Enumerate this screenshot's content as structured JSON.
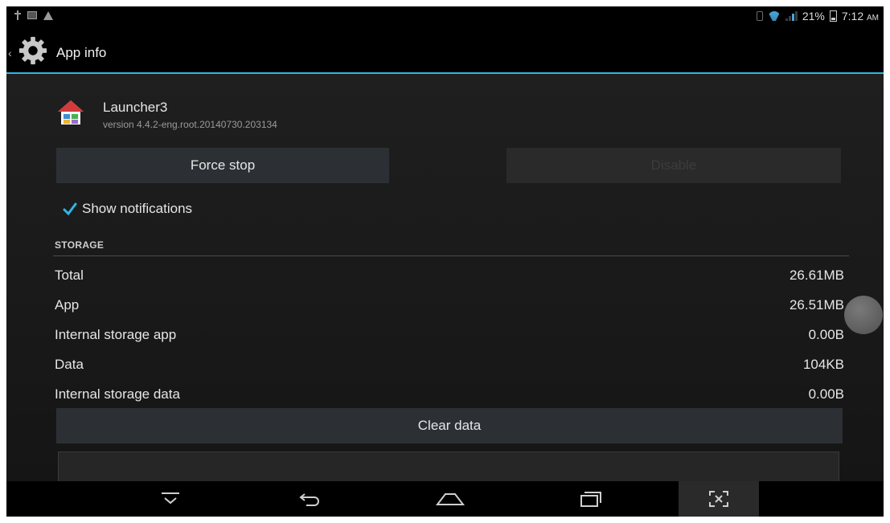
{
  "status_bar": {
    "battery": "21%",
    "time": "7:12",
    "ampm": "AM"
  },
  "action_bar": {
    "title": "App info"
  },
  "app": {
    "name": "Launcher3",
    "version": "version 4.4.2-eng.root.20140730.203134"
  },
  "buttons": {
    "force_stop": "Force stop",
    "disable": "Disable",
    "clear_data": "Clear data"
  },
  "notifications": {
    "label": "Show notifications",
    "checked": true
  },
  "storage": {
    "header": "STORAGE",
    "rows": [
      {
        "label": "Total",
        "value": "26.61MB"
      },
      {
        "label": "App",
        "value": "26.51MB"
      },
      {
        "label": "Internal storage app",
        "value": "0.00B"
      },
      {
        "label": "Data",
        "value": "104KB"
      },
      {
        "label": "Internal storage data",
        "value": "0.00B"
      }
    ]
  },
  "colors": {
    "accent": "#33b5e5",
    "button_bg": "#2c3035",
    "background": "#1a1a1a"
  }
}
